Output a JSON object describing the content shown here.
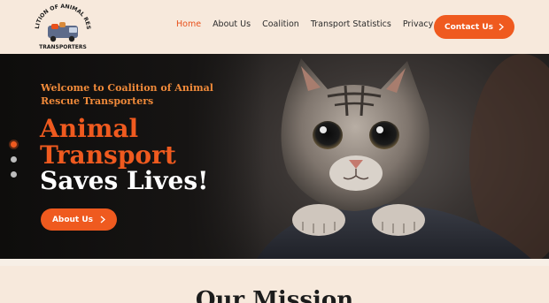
{
  "header": {
    "logo_text_top": "COALITION OF ANIMAL RESCUE",
    "logo_text_bottom": "TRANSPORTERS",
    "nav": [
      {
        "label": "Home",
        "active": true
      },
      {
        "label": "About Us",
        "active": false
      },
      {
        "label": "Coalition",
        "active": false
      },
      {
        "label": "Transport Statistics",
        "active": false
      },
      {
        "label": "Privacy",
        "active": false
      }
    ],
    "contact_label": "Contact Us"
  },
  "hero": {
    "welcome": "Welcome to Coalition of Animal Rescue Transporters",
    "title_line1": "Animal",
    "title_line2": "Transport",
    "title_line3": "Saves Lives!",
    "button_label": "About Us",
    "slides_count": 3,
    "active_slide": 1
  },
  "mission": {
    "title": "Our Mission"
  },
  "colors": {
    "accent": "#ef5a1f",
    "header_bg": "#f7e9dc",
    "welcome": "#f08a3a"
  },
  "icons": {
    "chevron": "chevron-right-icon"
  }
}
